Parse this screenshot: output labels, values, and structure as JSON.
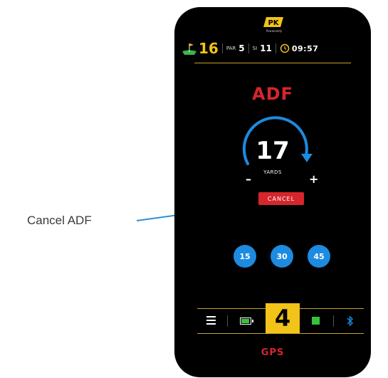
{
  "annotation": {
    "label": "Cancel ADF"
  },
  "brand": {
    "logo_text": "PK",
    "logo_sub": "Powakaddy"
  },
  "status_bar": {
    "hole": "16",
    "par_label": "PAR",
    "par_value": "5",
    "si_label": "SI",
    "si_value": "11",
    "time": "09:57"
  },
  "screen": {
    "title": "ADF",
    "distance_value": "17",
    "distance_unit": "YARDS",
    "decrease_label": "–",
    "increase_label": "+",
    "cancel_label": "CANCEL",
    "presets": [
      "15",
      "30",
      "45"
    ]
  },
  "toolbar": {
    "gear": "4"
  },
  "footer": {
    "mode": "GPS"
  },
  "colors": {
    "accent_red": "#d6262c",
    "accent_yellow": "#f2c318",
    "accent_blue": "#1c8be0",
    "battery_green": "#37c23e",
    "divider_gold": "#caa326"
  },
  "icons": [
    "flag-icon",
    "clock-icon",
    "menu-icon",
    "battery-icon",
    "status-square-icon",
    "bluetooth-icon",
    "arrow-icon"
  ]
}
